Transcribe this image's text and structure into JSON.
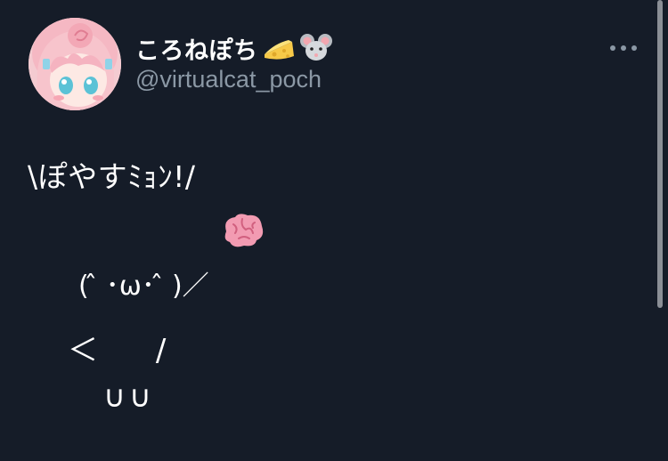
{
  "user": {
    "display_name": "ころねぽち",
    "handle": "@virtualcat_poch",
    "name_emojis": [
      "cheese-emoji",
      "mouse-emoji"
    ]
  },
  "tweet": {
    "text": "\\ぽやすﾐｮﾝ!/",
    "ascii_art": {
      "line1": "( ̂ ･ω･ ̂ )／",
      "line2": "＜      /",
      "line3": "∪∪"
    },
    "emoji": "brain-emoji"
  },
  "colors": {
    "background": "#151c28",
    "text_primary": "#ffffff",
    "text_secondary": "#8b98a5",
    "scrollbar": "#8b8f96"
  }
}
